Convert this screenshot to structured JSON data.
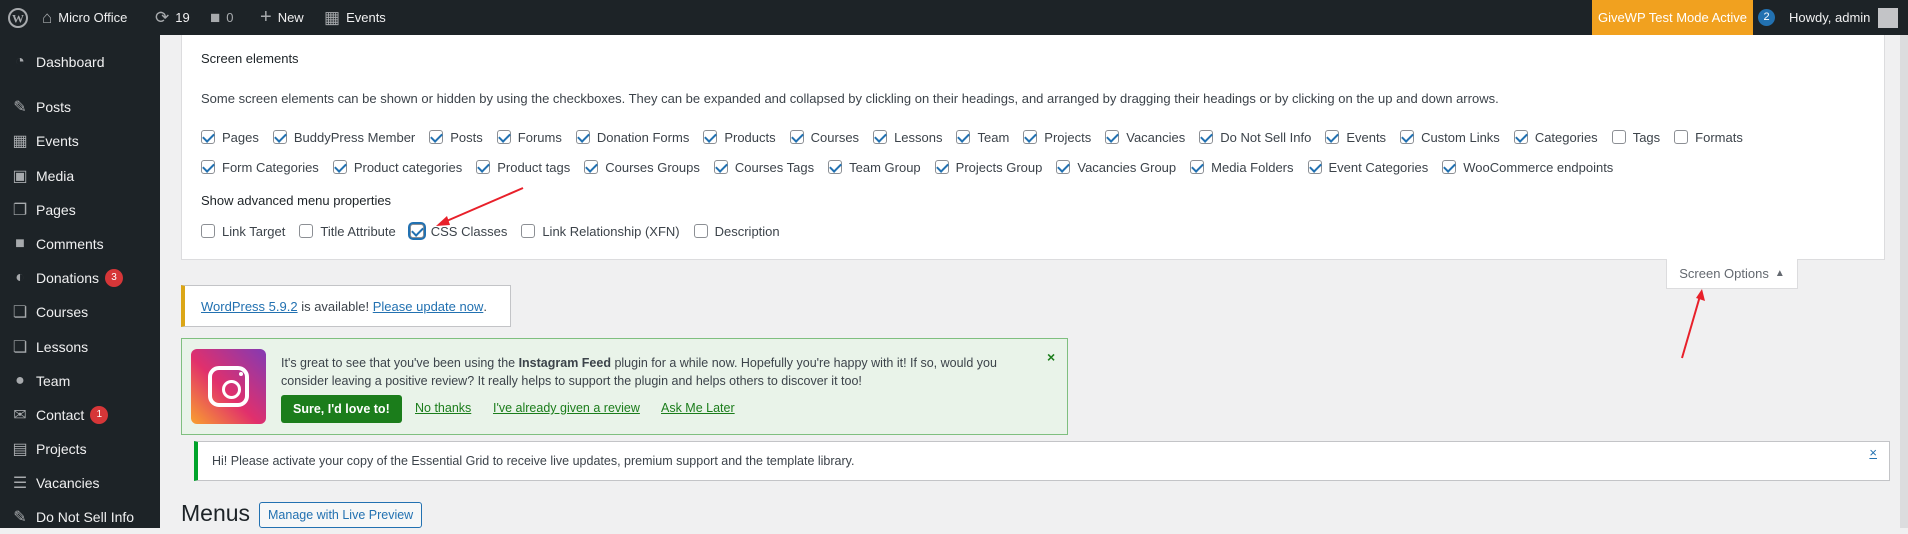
{
  "adminbar": {
    "site_name": "Micro Office",
    "updates_count": "19",
    "comments_count": "0",
    "new_label": "New",
    "events_label": "Events",
    "givewp_label": "GiveWP Test Mode Active",
    "notification_count": "2",
    "howdy_label": "Howdy, admin"
  },
  "sidebar": {
    "items": [
      {
        "label": "Dashboard",
        "icon": "dashboard-icon"
      },
      {
        "label": "Posts",
        "icon": "pin-icon"
      },
      {
        "label": "Events",
        "icon": "calendar-icon"
      },
      {
        "label": "Media",
        "icon": "media-icon"
      },
      {
        "label": "Pages",
        "icon": "pages-icon"
      },
      {
        "label": "Comments",
        "icon": "comment-icon"
      },
      {
        "label": "Donations",
        "icon": "give-icon",
        "badge": "3"
      },
      {
        "label": "Courses",
        "icon": "courses-icon"
      },
      {
        "label": "Lessons",
        "icon": "lessons-icon"
      },
      {
        "label": "Team",
        "icon": "person-icon"
      },
      {
        "label": "Contact",
        "icon": "mail-icon",
        "badge": "1"
      },
      {
        "label": "Projects",
        "icon": "document-icon"
      },
      {
        "label": "Vacancies",
        "icon": "list-icon"
      },
      {
        "label": "Do Not Sell Info",
        "icon": "pin-icon"
      }
    ]
  },
  "screen_elements": {
    "title": "Screen elements",
    "description": "Some screen elements can be shown or hidden by using the checkboxes. They can be expanded and collapsed by clickling on their headings, and arranged by dragging their headings or by clicking on the up and down arrows.",
    "row1": [
      {
        "label": "Pages",
        "checked": true
      },
      {
        "label": "BuddyPress Member",
        "checked": true
      },
      {
        "label": "Posts",
        "checked": true
      },
      {
        "label": "Forums",
        "checked": true
      },
      {
        "label": "Donation Forms",
        "checked": true
      },
      {
        "label": "Products",
        "checked": true
      },
      {
        "label": "Courses",
        "checked": true
      },
      {
        "label": "Lessons",
        "checked": true
      },
      {
        "label": "Team",
        "checked": true
      },
      {
        "label": "Projects",
        "checked": true
      },
      {
        "label": "Vacancies",
        "checked": true
      },
      {
        "label": "Do Not Sell Info",
        "checked": true
      },
      {
        "label": "Events",
        "checked": true
      },
      {
        "label": "Custom Links",
        "checked": true
      },
      {
        "label": "Categories",
        "checked": true
      },
      {
        "label": "Tags",
        "checked": false
      },
      {
        "label": "Formats",
        "checked": false
      }
    ],
    "row2": [
      {
        "label": "Form Categories",
        "checked": true
      },
      {
        "label": "Product categories",
        "checked": true
      },
      {
        "label": "Product tags",
        "checked": true
      },
      {
        "label": "Courses Groups",
        "checked": true
      },
      {
        "label": "Courses Tags",
        "checked": true
      },
      {
        "label": "Team Group",
        "checked": true
      },
      {
        "label": "Projects Group",
        "checked": true
      },
      {
        "label": "Vacancies Group",
        "checked": true
      },
      {
        "label": "Media Folders",
        "checked": true
      },
      {
        "label": "Event Categories",
        "checked": true
      },
      {
        "label": "WooCommerce endpoints",
        "checked": true
      }
    ],
    "advanced_title": "Show advanced menu properties",
    "advanced": [
      {
        "label": "Link Target",
        "checked": false
      },
      {
        "label": "Title Attribute",
        "checked": false
      },
      {
        "label": "CSS Classes",
        "checked": true
      },
      {
        "label": "Link Relationship (XFN)",
        "checked": false
      },
      {
        "label": "Description",
        "checked": false
      }
    ]
  },
  "screen_options": {
    "label": "Screen Options",
    "arrow": "▲"
  },
  "update_notice": {
    "version_link": "WordPress 5.9.2",
    "middle": " is available! ",
    "update_link": "Please update now",
    "end": "."
  },
  "instagram_notice": {
    "text_before": "It's great to see that you've been using the ",
    "plugin_name": "Instagram Feed",
    "text_after": " plugin for a while now. Hopefully you're happy with it!  If so, would you consider leaving a positive review? It really helps to support the plugin and helps others to discover it too!",
    "primary_button": "Sure, I'd love to!",
    "link1": "No thanks",
    "link2": "I've already given a review",
    "link3": "Ask Me Later",
    "close": "×"
  },
  "grid_notice": {
    "text": "Hi! Please activate your copy of the Essential Grid to receive live updates, premium support and the template library.",
    "close": "×"
  },
  "menus": {
    "title": "Menus",
    "live_preview_button": "Manage with Live Preview"
  },
  "colors": {
    "admin_bar": "#1d2327",
    "accent": "#2271b1",
    "givewp": "#f1a11f",
    "annotation_arrow": "#e8202a"
  }
}
